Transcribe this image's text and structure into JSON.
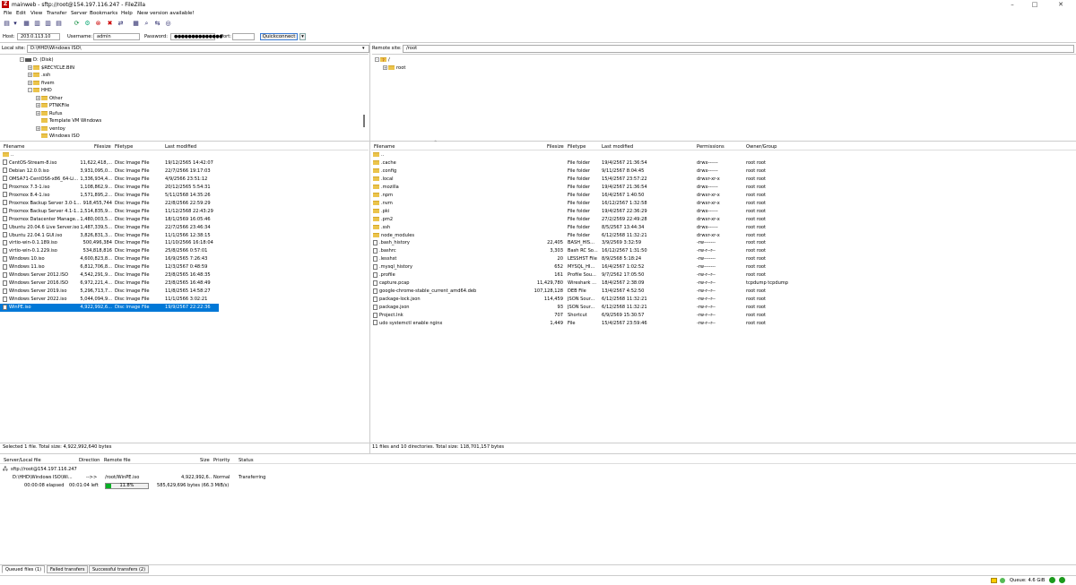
{
  "window": {
    "title": "mainweb - sftp://root@154.197.116.247 - FileZilla",
    "app_icon_letter": "Z"
  },
  "menu": [
    "File",
    "Edit",
    "View",
    "Transfer",
    "Server",
    "Bookmarks",
    "Help",
    "New version available!"
  ],
  "quickconnect": {
    "host_label": "Host:",
    "host_value": "203.0.113.10",
    "user_label": "Username:",
    "user_value": "admin",
    "pass_label": "Password:",
    "pass_value": "●●●●●●●●●●●●●●",
    "port_label": "Port:",
    "port_value": "",
    "button": "Quickconnect"
  },
  "local": {
    "site_label": "Local site:",
    "site_path": "D:\\HHD\\Windows ISO\\",
    "tree": [
      {
        "label": "D: (Disk)",
        "level": 0,
        "type": "drive",
        "exp": "-"
      },
      {
        "label": "$RECYCLE.BIN",
        "level": 1,
        "type": "folder",
        "exp": "+"
      },
      {
        "label": ".ssh",
        "level": 1,
        "type": "folder",
        "exp": "+"
      },
      {
        "label": "fivem",
        "level": 1,
        "type": "folder",
        "exp": "+"
      },
      {
        "label": "HHD",
        "level": 1,
        "type": "folder",
        "exp": "-"
      },
      {
        "label": "Other",
        "level": 2,
        "type": "folder",
        "exp": "+"
      },
      {
        "label": "PTNKFile",
        "level": 2,
        "type": "folder",
        "exp": "+"
      },
      {
        "label": "Rufus",
        "level": 2,
        "type": "folder",
        "exp": "+"
      },
      {
        "label": "Template VM Windows",
        "level": 2,
        "type": "folder",
        "exp": ""
      },
      {
        "label": "ventoy",
        "level": 2,
        "type": "folder",
        "exp": "+"
      },
      {
        "label": "Windows ISO",
        "level": 2,
        "type": "folder",
        "exp": ""
      }
    ],
    "columns": [
      "Filename",
      "Filesize",
      "Filetype",
      "Last modified"
    ],
    "files": [
      {
        "name": "..",
        "size": "",
        "type": "",
        "date": "",
        "folder": true
      },
      {
        "name": "CentOS-Stream-8.iso",
        "size": "11,622,418,...",
        "type": "Disc Image File",
        "date": "19/12/2565 14:42:07"
      },
      {
        "name": "Debian 12.0.0.iso",
        "size": "3,931,095,0...",
        "type": "Disc Image File",
        "date": "22/7/2566 19:17:03"
      },
      {
        "name": "OMSA71-CentOS6-x86_64-Li...",
        "size": "1,336,934,4...",
        "type": "Disc Image File",
        "date": "4/9/2566 23:51:12"
      },
      {
        "name": "Proxmox 7.3-1.iso",
        "size": "1,108,862,9...",
        "type": "Disc Image File",
        "date": "20/12/2565 5:54:31"
      },
      {
        "name": "Proxmox 8.4-1.iso",
        "size": "1,571,895,2...",
        "type": "Disc Image File",
        "date": "5/11/2568 14:35:26"
      },
      {
        "name": "Proxmox Backup Server 3.0-1...",
        "size": "918,455,744",
        "type": "Disc Image File",
        "date": "22/8/2566 22:59:29"
      },
      {
        "name": "Proxmox Backup Server 4.1-1...",
        "size": "1,514,835,9...",
        "type": "Disc Image File",
        "date": "11/12/2568 22:43:29"
      },
      {
        "name": "Proxmox Datacenter Manage...",
        "size": "1,480,003,5...",
        "type": "Disc Image File",
        "date": "18/1/2569 16:05:46"
      },
      {
        "name": "Ubuntu 20.04.6 Live Server.iso",
        "size": "1,487,339,5...",
        "type": "Disc Image File",
        "date": "22/7/2566 23:46:34"
      },
      {
        "name": "Ubuntu 22.04.1 GUI.iso",
        "size": "3,826,831,3...",
        "type": "Disc Image File",
        "date": "11/1/2566 12:38:15"
      },
      {
        "name": "virtio-win-0.1.189.iso",
        "size": "500,496,384",
        "type": "Disc Image File",
        "date": "11/10/2566 16:18:04"
      },
      {
        "name": "virtio-win-0.1.229.iso",
        "size": "534,818,816",
        "type": "Disc Image File",
        "date": "25/8/2566 0:57:01"
      },
      {
        "name": "Windows 10.iso",
        "size": "4,600,823,8...",
        "type": "Disc Image File",
        "date": "16/9/2565 7:26:43"
      },
      {
        "name": "Windows 11.iso",
        "size": "6,812,706,8...",
        "type": "Disc Image File",
        "date": "12/3/2567 0:48:59"
      },
      {
        "name": "Windows Server 2012.ISO",
        "size": "4,542,291,9...",
        "type": "Disc Image File",
        "date": "23/8/2565 16:48:35"
      },
      {
        "name": "Windows Server 2016.ISO",
        "size": "6,972,221,4...",
        "type": "Disc Image File",
        "date": "23/8/2565 16:48:49"
      },
      {
        "name": "Windows Server 2019.iso",
        "size": "5,296,713,7...",
        "type": "Disc Image File",
        "date": "11/8/2565 14:58:27"
      },
      {
        "name": "Windows Server 2022.iso",
        "size": "5,044,094,9...",
        "type": "Disc Image File",
        "date": "11/1/2566 3:02:21"
      },
      {
        "name": "WinPE.iso",
        "size": "4,922,992,6...",
        "type": "Disc Image File",
        "date": "19/9/2567 22:22:36",
        "selected": true
      }
    ],
    "status": "Selected 1 file. Total size: 4,922,992,640 bytes"
  },
  "remote": {
    "site_label": "Remote site:",
    "site_path": "/root",
    "tree": [
      {
        "label": "/",
        "level": 0,
        "type": "question",
        "exp": "-"
      },
      {
        "label": "root",
        "level": 1,
        "type": "folder",
        "exp": "+"
      }
    ],
    "columns": [
      "Filename",
      "Filesize",
      "Filetype",
      "Last modified",
      "Permissions",
      "Owner/Group"
    ],
    "files": [
      {
        "name": "..",
        "size": "",
        "type": "",
        "date": "",
        "perm": "",
        "owner": "",
        "folder": true
      },
      {
        "name": ".cache",
        "size": "",
        "type": "File folder",
        "date": "19/4/2567 21:36:54",
        "perm": "drwx------",
        "owner": "root root",
        "folder": true
      },
      {
        "name": ".config",
        "size": "",
        "type": "File folder",
        "date": "9/11/2567 8:04:45",
        "perm": "drwx------",
        "owner": "root root",
        "folder": true
      },
      {
        "name": ".local",
        "size": "",
        "type": "File folder",
        "date": "15/4/2567 23:57:22",
        "perm": "drwxr-xr-x",
        "owner": "root root",
        "folder": true
      },
      {
        "name": ".mozilla",
        "size": "",
        "type": "File folder",
        "date": "19/4/2567 21:36:54",
        "perm": "drwx------",
        "owner": "root root",
        "folder": true
      },
      {
        "name": ".npm",
        "size": "",
        "type": "File folder",
        "date": "16/4/2567 1:40:50",
        "perm": "drwxr-xr-x",
        "owner": "root root",
        "folder": true
      },
      {
        "name": ".nvm",
        "size": "",
        "type": "File folder",
        "date": "16/12/2567 1:32:58",
        "perm": "drwxr-xr-x",
        "owner": "root root",
        "folder": true
      },
      {
        "name": ".pki",
        "size": "",
        "type": "File folder",
        "date": "19/4/2567 22:36:29",
        "perm": "drwx------",
        "owner": "root root",
        "folder": true
      },
      {
        "name": ".pm2",
        "size": "",
        "type": "File folder",
        "date": "27/2/2569 22:49:28",
        "perm": "drwxr-xr-x",
        "owner": "root root",
        "folder": true
      },
      {
        "name": ".ssh",
        "size": "",
        "type": "File folder",
        "date": "8/5/2567 13:44:34",
        "perm": "drwx------",
        "owner": "root root",
        "folder": true
      },
      {
        "name": "node_modules",
        "size": "",
        "type": "File folder",
        "date": "6/12/2568 11:32:21",
        "perm": "drwxr-xr-x",
        "owner": "root root",
        "folder": true
      },
      {
        "name": ".bash_history",
        "size": "22,405",
        "type": "BASH_HIS...",
        "date": "3/9/2569 3:32:59",
        "perm": "-rw-------",
        "owner": "root root"
      },
      {
        "name": ".bashrc",
        "size": "3,303",
        "type": "Bash RC So...",
        "date": "16/12/2567 1:31:50",
        "perm": "-rw-r--r--",
        "owner": "root root"
      },
      {
        "name": ".lesshst",
        "size": "20",
        "type": "LESSHST File",
        "date": "8/9/2568 5:18:24",
        "perm": "-rw-------",
        "owner": "root root"
      },
      {
        "name": ".mysql_history",
        "size": "652",
        "type": "MYSQL_HI...",
        "date": "16/4/2567 1:02:52",
        "perm": "-rw-------",
        "owner": "root root"
      },
      {
        "name": ".profile",
        "size": "161",
        "type": "Profile Sou...",
        "date": "9/7/2562 17:05:50",
        "perm": "-rw-r--r--",
        "owner": "root root"
      },
      {
        "name": "capture.pcap",
        "size": "11,429,780",
        "type": "Wireshark ...",
        "date": "18/4/2567 2:38:09",
        "perm": "-rw-r--r--",
        "owner": "tcpdump tcpdump"
      },
      {
        "name": "google-chrome-stable_current_amd64.deb",
        "size": "107,128,128",
        "type": "DEB File",
        "date": "13/4/2567 4:52:50",
        "perm": "-rw-r--r--",
        "owner": "root root"
      },
      {
        "name": "package-lock.json",
        "size": "114,459",
        "type": "JSON Sour...",
        "date": "6/12/2568 11:32:21",
        "perm": "-rw-r--r--",
        "owner": "root root"
      },
      {
        "name": "package.json",
        "size": "93",
        "type": "JSON Sour...",
        "date": "6/12/2568 11:32:21",
        "perm": "-rw-r--r--",
        "owner": "root root"
      },
      {
        "name": "Project.lnk",
        "size": "707",
        "type": "Shortcut",
        "date": "6/9/2569 15:30:57",
        "perm": "-rw-r--r--",
        "owner": "root root"
      },
      {
        "name": "udo systemctl enable nginx",
        "size": "1,449",
        "type": "File",
        "date": "15/4/2567 23:59:46",
        "perm": "-rw-r--r--",
        "owner": "root root"
      }
    ],
    "status": "11 files and 10 directories. Total size: 118,701,157 bytes"
  },
  "queue": {
    "columns": [
      "Server/Local file",
      "Direction",
      "Remote file",
      "Size",
      "Priority",
      "Status"
    ],
    "server": "sftp://root@154.197.116.247",
    "local_file": "D:\\HHD\\Windows ISO\\Wi...",
    "direction": "-->>",
    "remote_file": "/root/WinPE.iso",
    "size": "4,922,992,6...",
    "priority": "Normal",
    "status": "Transferring",
    "elapsed": "00:00:08 elapsed",
    "left": "00:01:04 left",
    "progress_percent": 11.8,
    "progress_label": "11.8%",
    "bytes": "585,629,696 bytes (66.3 MiB/s)"
  },
  "tabs": [
    "Queued files (1)",
    "Failed transfers",
    "Successful transfers (2)"
  ],
  "bottom": {
    "queue_label": "Queue: 4.6 GiB"
  },
  "colors": {
    "selection": "#0078d7",
    "folder": "#ebc44c",
    "progress": "#06b025"
  }
}
